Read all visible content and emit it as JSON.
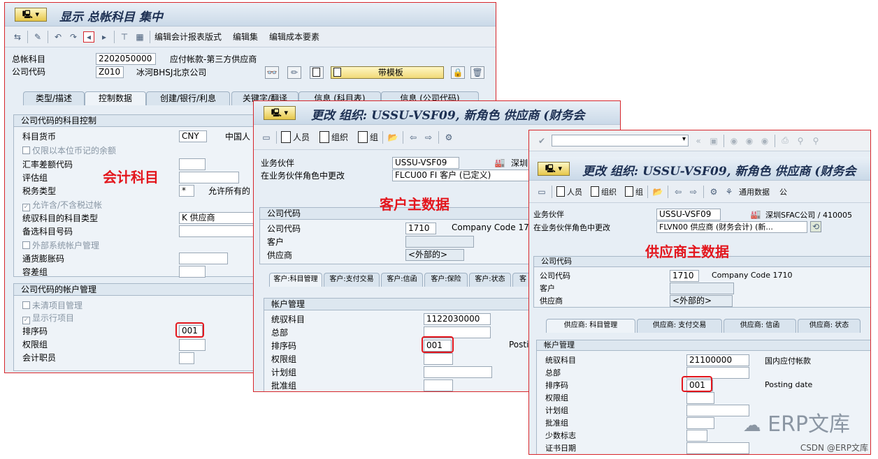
{
  "win1": {
    "icon": "🖳",
    "title": "显示 总帐科目 集中",
    "toolbar": [
      "编辑会计报表版式",
      "编辑集",
      "编辑成本要素"
    ],
    "gl_label": "总帐科目",
    "gl_value": "2202050000",
    "gl_desc": "应付帐款-第三方供应商",
    "cc_label": "公司代码",
    "cc_value": "Z010",
    "cc_desc": "冰河BHSJ北京公司",
    "template_btn": "带模板",
    "tabs": [
      "类型/描述",
      "控制数据",
      "创建/银行/利息",
      "关键字/翻译",
      "信息 (科目表)",
      "信息 (公司代码)"
    ],
    "box1_title": "公司代码的科目控制",
    "rows1": {
      "currency_label": "科目货币",
      "currency_value": "CNY",
      "currency_desc": "中国人",
      "local_bal": "仅限以本位币记的余额",
      "fx_key": "汇率差额代码",
      "valuation": "评估组",
      "tax_label": "税务类型",
      "tax_value": "*",
      "tax_desc": "允许所有的",
      "no_tax": "允许含/不含税过帐",
      "recon_label": "统驭科目的科目类型",
      "recon_value": "K 供应商",
      "alt_acct": "备选科目号码",
      "ext_mgmt": "外部系统帐户管理",
      "inflation": "通货膨胀码",
      "tolerance": "容差组"
    },
    "box2_title": "公司代码的帐户管理",
    "rows2": {
      "open_item": "未清项目管理",
      "line_item": "显示行项目",
      "sort_label": "排序码",
      "sort_value": "001",
      "auth": "权限组",
      "clerk": "会计职员"
    },
    "annotation": "会计科目"
  },
  "win2": {
    "icon": "🖳",
    "title": "更改 组织: USSU-VSF09, 新角色 供应商 (财务会",
    "toolbar": [
      "人员",
      "组织",
      "组"
    ],
    "bp_label": "业务伙伴",
    "bp_value": "USSU-VSF09",
    "bp_desc": "深圳",
    "role_label": "在业务伙伴角色中更改",
    "role_value": "FLCU00 FI 客户 (已定义)",
    "box_title": "公司代码",
    "cc_label": "公司代码",
    "cc_value": "1710",
    "cc_desc": "Company Code 17",
    "cust_label": "客户",
    "vend_label": "供应商",
    "vend_value": "<外部的>",
    "tabs": [
      "客户:科目管理",
      "客户:支付交易",
      "客户:信函",
      "客户:保险",
      "客户:状态",
      "客"
    ],
    "acct_title": "帐户管理",
    "recon": "统驭科目",
    "recon_value": "1122030000",
    "head": "总部",
    "sort": "排序码",
    "sort_value": "001",
    "sort_desc": "Posti",
    "auth": "权限组",
    "plan": "计划组",
    "release": "批准组",
    "annotation": "客户主数据"
  },
  "win3": {
    "title": "更改 组织: USSU-VSF09, 新角色 供应商 (财务会",
    "toolbar": [
      "人员",
      "组织",
      "组",
      "通用数据",
      "公"
    ],
    "bp_label": "业务伙伴",
    "bp_value": "USSU-VSF09",
    "bp_desc": "深圳SFAC公司 / 410005 ",
    "role_label": "在业务伙伴角色中更改",
    "role_value": "FLVN00 供应商 (财务会计) (新...",
    "box_title": "公司代码",
    "cc_label": "公司代码",
    "cc_value": "1710",
    "cc_desc": "Company Code 1710",
    "cust_label": "客户",
    "vend_label": "供应商",
    "vend_value": "<外部的>",
    "tabs": [
      "供应商: 科目管理",
      "供应商: 支付交易",
      "供应商: 信函",
      "供应商: 状态"
    ],
    "acct_title": "帐户管理",
    "recon": "统驭科目",
    "recon_value": "21100000",
    "recon_desc": "国内应付帐款",
    "head": "总部",
    "sort": "排序码",
    "sort_value": "001",
    "sort_desc": "Posting date",
    "auth": "权限组",
    "plan": "计划组",
    "release": "批准组",
    "minority": "少数标志",
    "cert": "证书日期",
    "annotation": "供应商主数据"
  },
  "watermark": "ERP文库",
  "credit": "CSDN @ERP文库",
  "colors": {
    "annotation": "#e3161d",
    "frame": "#d7262b",
    "title": "#1c2f52"
  }
}
